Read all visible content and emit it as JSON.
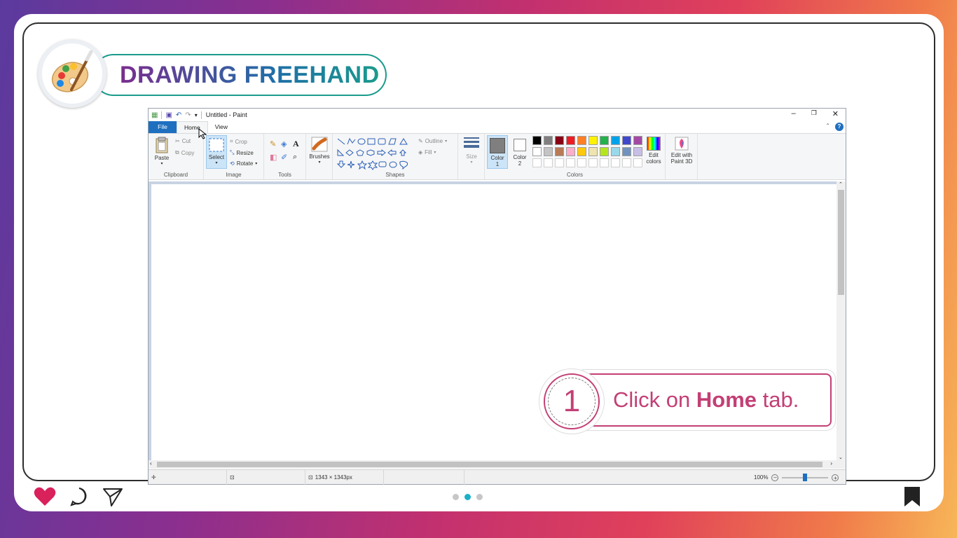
{
  "header": {
    "title": "DRAWING FREEHAND",
    "logo_icon": "paint-palette-icon"
  },
  "paint": {
    "window_title": "Untitled - Paint",
    "tabs": [
      "File",
      "Home",
      "View"
    ],
    "clipboard": {
      "paste": "Paste",
      "cut": "Cut",
      "copy": "Copy",
      "label": "Clipboard"
    },
    "image": {
      "select": "Select",
      "crop": "Crop",
      "resize": "Resize",
      "rotate": "Rotate",
      "label": "Image"
    },
    "tools": {
      "label": "Tools"
    },
    "brushes": {
      "label": "Brushes"
    },
    "shapes": {
      "outline": "Outline",
      "fill": "Fill",
      "label": "Shapes"
    },
    "size": {
      "label": "Size"
    },
    "colors": {
      "color1": "Color 1",
      "color2": "Color 2",
      "edit_colors": "Edit colors",
      "edit_paint3d": "Edit with Paint 3D",
      "label": "Colors",
      "row1": [
        "#000000",
        "#7f7f7f",
        "#880015",
        "#ed1c24",
        "#ff7f27",
        "#fff200",
        "#22b14c",
        "#00a2e8",
        "#3f48cc",
        "#a349a4"
      ],
      "row2": [
        "#ffffff",
        "#c3c3c3",
        "#b97a57",
        "#ffaec9",
        "#ffc90e",
        "#efe4b0",
        "#b5e61d",
        "#99d9ea",
        "#7092be",
        "#c8bfe7"
      ],
      "row3": [
        "#ffffff",
        "#ffffff",
        "#ffffff",
        "#ffffff",
        "#ffffff",
        "#ffffff",
        "#ffffff",
        "#ffffff",
        "#ffffff",
        "#ffffff"
      ],
      "color1_value": "#7f7f7f",
      "color2_value": "#ffffff"
    },
    "status": {
      "dimensions": "1343 × 1343px",
      "zoom": "100%"
    }
  },
  "step": {
    "number": "1",
    "text_before": "Click on ",
    "text_bold": "Home",
    "text_after": " tab."
  },
  "footer": {
    "dots_count": 3,
    "active_dot": 2
  }
}
